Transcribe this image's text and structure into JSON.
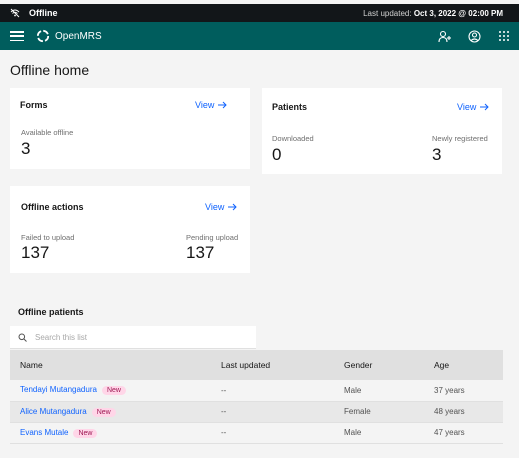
{
  "offline_bar": {
    "status": "Offline",
    "last_updated_label": "Last updated:",
    "last_updated_value": "Oct 3, 2022 @ 02:00 PM"
  },
  "header": {
    "logo_text": "OpenMRS"
  },
  "page": {
    "title": "Offline home"
  },
  "tiles": {
    "forms": {
      "title": "Forms",
      "link": "View",
      "stat_label": "Available offline",
      "stat_value": "3"
    },
    "patients": {
      "title": "Patients",
      "link": "View",
      "downloaded_label": "Downloaded",
      "downloaded_value": "0",
      "registered_label": "Newly registered",
      "registered_value": "3"
    },
    "actions": {
      "title": "Offline actions",
      "link": "View",
      "failed_label": "Failed to upload",
      "failed_value": "137",
      "pending_label": "Pending upload",
      "pending_value": "137"
    }
  },
  "offline_patients": {
    "title": "Offline patients",
    "search_placeholder": "Search this list",
    "columns": [
      "Name",
      "Last updated",
      "Gender",
      "Age"
    ],
    "rows": [
      {
        "name": "Tendayi Mutangadura",
        "tag": "New",
        "last_updated": "--",
        "gender": "Male",
        "age": "37 years"
      },
      {
        "name": "Alice Mutangadura",
        "tag": "New",
        "last_updated": "--",
        "gender": "Female",
        "age": "48 years"
      },
      {
        "name": "Evans Mutale",
        "tag": "New",
        "last_updated": "--",
        "gender": "Male",
        "age": "47 years"
      }
    ]
  },
  "colors": {
    "header_bg": "#005d5d",
    "offline_bar_bg": "#121619",
    "link": "#0f62fe",
    "tag_bg": "#ffd6e8"
  }
}
